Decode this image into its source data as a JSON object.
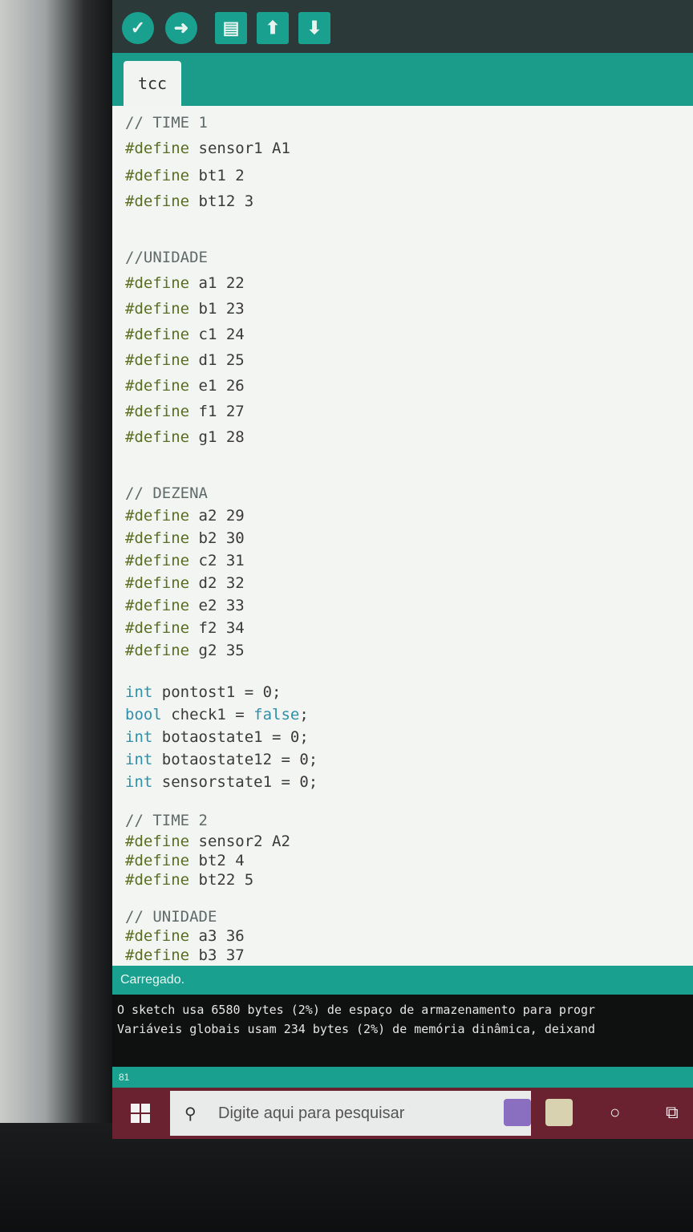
{
  "toolbar": {
    "buttons": [
      {
        "name": "verify-button",
        "glyph": "✓"
      },
      {
        "name": "upload-button",
        "glyph": "➜"
      },
      {
        "name": "new-button",
        "glyph": "▤"
      },
      {
        "name": "open-button",
        "glyph": "⬆"
      },
      {
        "name": "save-button",
        "glyph": "⬇"
      }
    ]
  },
  "tab": {
    "label": "tcc"
  },
  "code_lines": [
    {
      "text": "// TIME 1",
      "kind": "comment"
    },
    {
      "text": "#define sensor1 A1",
      "kind": "define"
    },
    {
      "text": "#define bt1 2",
      "kind": "define"
    },
    {
      "text": "#define bt12 3",
      "kind": "define"
    },
    {
      "text": "",
      "kind": "blank"
    },
    {
      "text": "//UNIDADE",
      "kind": "comment"
    },
    {
      "text": "#define a1 22",
      "kind": "define"
    },
    {
      "text": "#define b1 23",
      "kind": "define"
    },
    {
      "text": "#define c1 24",
      "kind": "define"
    },
    {
      "text": "#define d1 25",
      "kind": "define"
    },
    {
      "text": "#define e1 26",
      "kind": "define"
    },
    {
      "text": "#define f1 27",
      "kind": "define"
    },
    {
      "text": "#define g1 28",
      "kind": "define"
    },
    {
      "text": "",
      "kind": "blank"
    },
    {
      "text": "// DEZENA",
      "kind": "comment"
    },
    {
      "text": "#define a2 29",
      "kind": "define"
    },
    {
      "text": "#define b2 30",
      "kind": "define"
    },
    {
      "text": "#define c2 31",
      "kind": "define"
    },
    {
      "text": "#define d2 32",
      "kind": "define"
    },
    {
      "text": "#define e2 33",
      "kind": "define"
    },
    {
      "text": "#define f2 34",
      "kind": "define"
    },
    {
      "text": "#define g2 35",
      "kind": "define"
    },
    {
      "text": "",
      "kind": "blank"
    },
    {
      "text": "int pontost1 = 0;",
      "kind": "int"
    },
    {
      "text": "bool check1 = false;",
      "kind": "bool"
    },
    {
      "text": "int botaostate1 = 0;",
      "kind": "int"
    },
    {
      "text": "int botaostate12 = 0;",
      "kind": "int"
    },
    {
      "text": "int sensorstate1 = 0;",
      "kind": "int"
    },
    {
      "text": "",
      "kind": "blank"
    },
    {
      "text": "// TIME 2",
      "kind": "comment"
    },
    {
      "text": "#define sensor2 A2",
      "kind": "define"
    },
    {
      "text": "#define bt2 4",
      "kind": "define"
    },
    {
      "text": "#define bt22 5",
      "kind": "define"
    },
    {
      "text": "",
      "kind": "blank"
    },
    {
      "text": "// UNIDADE",
      "kind": "comment"
    },
    {
      "text": "#define a3 36",
      "kind": "define"
    },
    {
      "text": "#define b3 37",
      "kind": "define"
    }
  ],
  "status": {
    "message": "Carregado."
  },
  "console": {
    "line1": "O sketch usa 6580 bytes (2%) de espaço de armazenamento para progr",
    "line2": "Variáveis globais usam 234 bytes (2%) de memória dinâmica, deixand"
  },
  "footer": {
    "line_number": "81"
  },
  "taskbar": {
    "search_placeholder": "Digite aqui para pesquisar"
  },
  "colors": {
    "accent": "#1aa08f",
    "toolbar": "#2b3a38",
    "taskbar": "#6a2230"
  }
}
